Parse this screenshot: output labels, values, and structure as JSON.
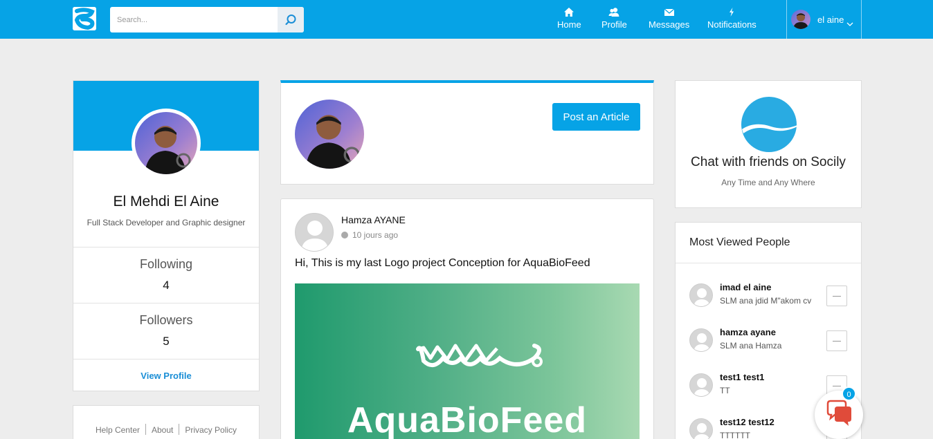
{
  "app": {
    "brand_color": "#06a3e6"
  },
  "header": {
    "search": {
      "placeholder": "Search..."
    },
    "nav": [
      {
        "label": "Home",
        "icon": "home-icon"
      },
      {
        "label": "Profile",
        "icon": "users-icon"
      },
      {
        "label": "Messages",
        "icon": "envelope-icon"
      },
      {
        "label": "Notifications",
        "icon": "bolt-icon"
      }
    ],
    "user": {
      "name": "el aine"
    }
  },
  "profile": {
    "name": "El Mehdi El Aine",
    "role": "Full Stack Developer and Graphic designer",
    "following_label": "Following",
    "following_count": "4",
    "followers_label": "Followers",
    "followers_count": "5",
    "view_profile": "View Profile"
  },
  "footer": {
    "links": [
      "Help Center",
      "About",
      "Privacy Policy"
    ]
  },
  "composer": {
    "post_button": "Post an Article"
  },
  "post": {
    "author": "Hamza AYANE",
    "time": "10 jours ago",
    "text": "Hi, This is my last Logo project Conception for AquaBioFeed",
    "image_brand": "AquaBioFeed"
  },
  "promo": {
    "title": "Chat with friends on Socily",
    "subtitle": "Any Time and Any Where"
  },
  "most_viewed": {
    "title": "Most Viewed People",
    "people": [
      {
        "name": "imad el aine",
        "message": "SLM ana jdid M\"akom cv"
      },
      {
        "name": "hamza ayane",
        "message": "SLM ana Hamza"
      },
      {
        "name": "test1 test1",
        "message": "TT"
      },
      {
        "name": "test12 test12",
        "message": "TTTTTT"
      }
    ]
  },
  "chat": {
    "unread": "0"
  }
}
